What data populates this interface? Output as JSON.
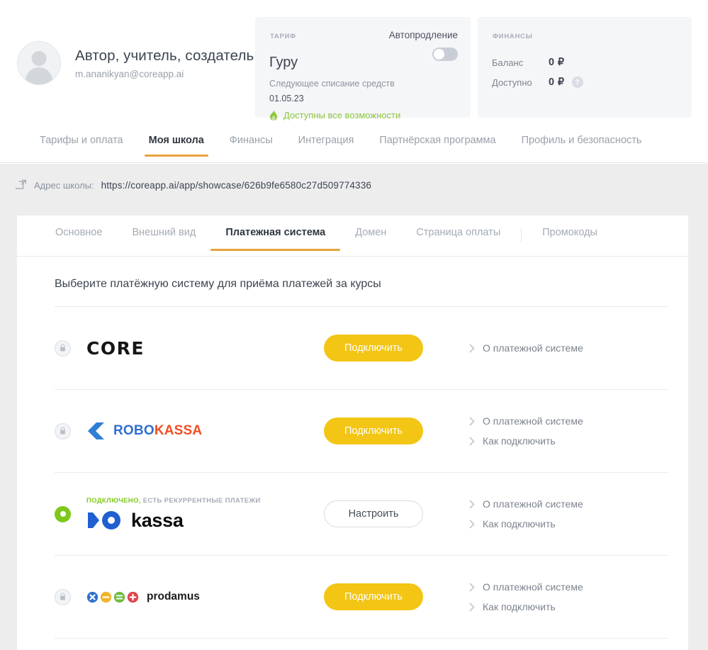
{
  "profile": {
    "name": "Автор, учитель, создатель",
    "email": "m.ananikyan@coreapp.ai"
  },
  "tariff_card": {
    "label": "ТАРИФ",
    "name": "Гуру",
    "next_charge_label": "Следующее списание средств",
    "next_charge_date": "01.05.23",
    "feature_text": "Доступны все возможности",
    "autorenew_label": "Автопродление",
    "autorenew_on": false,
    "feature_color": "#8ec63f"
  },
  "finance_card": {
    "label": "ФИНАНСЫ",
    "rows": [
      {
        "key": "Баланс",
        "value": "0 ₽",
        "help": false
      },
      {
        "key": "Доступно",
        "value": "0 ₽",
        "help": true
      }
    ],
    "help_glyph": "?"
  },
  "main_tabs": [
    {
      "label": "Тарифы и оплата",
      "active": false
    },
    {
      "label": "Моя школа",
      "active": true
    },
    {
      "label": "Финансы",
      "active": false
    },
    {
      "label": "Интеграция",
      "active": false
    },
    {
      "label": "Партнёрская программа",
      "active": false
    },
    {
      "label": "Профиль и безопасность",
      "active": false
    }
  ],
  "school_url": {
    "label": "Адрес школы:",
    "value": "https://coreapp.ai/app/showcase/626b9fe6580c27d509774336"
  },
  "sub_tabs": [
    {
      "label": "Основное",
      "active": false
    },
    {
      "label": "Внешний вид",
      "active": false
    },
    {
      "label": "Платежная система",
      "active": true
    },
    {
      "label": "Домен",
      "active": false
    },
    {
      "label": "Страница оплаты",
      "active": false
    },
    {
      "label": "Промокоды",
      "active": false
    }
  ],
  "panel_title": "Выберите платёжную систему для приёма платежей за курсы",
  "accent_color": "#e8a33d",
  "connect_button_color": "#f3c515",
  "payment_systems": [
    {
      "id": "core",
      "logo_text": "CORE",
      "status_connected": false,
      "status_text": "",
      "status_rest": "",
      "button_label": "Подключить",
      "button_kind": "connect",
      "links": [
        "О платежной системе"
      ]
    },
    {
      "id": "robokassa",
      "logo_text_primary": "ROBO",
      "logo_text_secondary": "KASSA",
      "status_connected": false,
      "status_text": "",
      "status_rest": "",
      "button_label": "Подключить",
      "button_kind": "connect",
      "links": [
        "О платежной системе",
        "Как подключить"
      ]
    },
    {
      "id": "yookassa",
      "logo_text": "kassa",
      "status_connected": true,
      "status_text": "ПОДКЛЮЧЕНО,",
      "status_rest": " ЕСТЬ РЕКУРРЕНТНЫЕ ПЛАТЕЖИ",
      "button_label": "Настроить",
      "button_kind": "setup",
      "links": [
        "О платежной системе",
        "Как подключить"
      ]
    },
    {
      "id": "prodamus",
      "logo_text": "prodamus",
      "status_connected": false,
      "status_text": "",
      "status_rest": "",
      "button_label": "Подключить",
      "button_kind": "connect",
      "links": [
        "О платежной системе",
        "Как подключить"
      ]
    }
  ]
}
